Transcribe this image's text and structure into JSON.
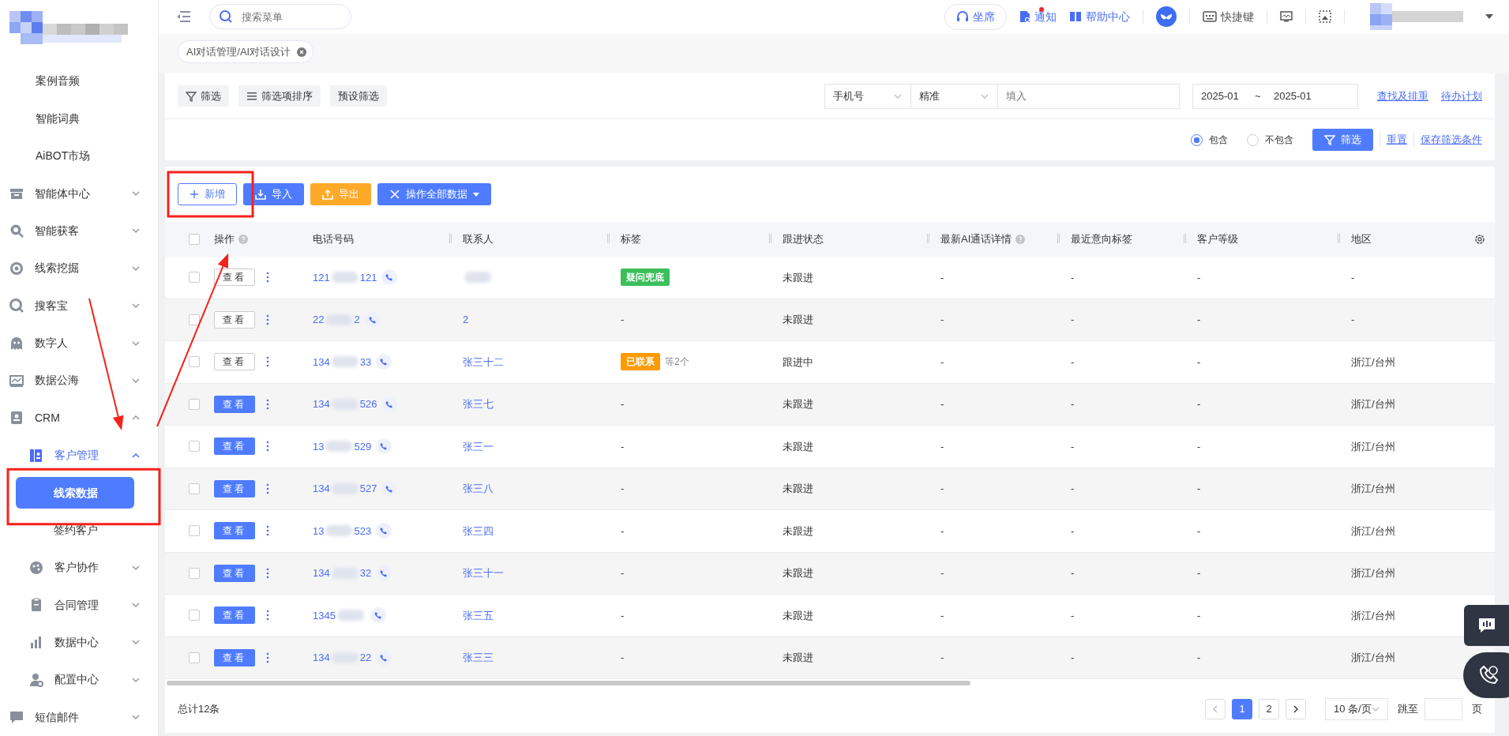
{
  "sidebar": {
    "items": [
      {
        "label": "案例音频",
        "selected": false
      },
      {
        "label": "智能词典",
        "selected": false
      },
      {
        "label": "AiBOT市场",
        "selected": false
      },
      {
        "label": "智能体中心",
        "expanded": false
      },
      {
        "label": "智能获客",
        "expanded": false
      },
      {
        "label": "线索挖掘",
        "expanded": false
      },
      {
        "label": "搜客宝",
        "expanded": false
      },
      {
        "label": "数字人",
        "expanded": false
      },
      {
        "label": "数据公海",
        "expanded": false
      },
      {
        "label": "CRM",
        "expanded": true,
        "children": [
          {
            "label": "客户管理",
            "expanded": true,
            "arrow_pointed": true,
            "children": [
              {
                "label": "线索数据",
                "selected": true,
                "boxed": true
              },
              {
                "label": "签约客户",
                "selected": false
              }
            ]
          },
          {
            "label": "客户协作",
            "expanded": false
          },
          {
            "label": "合同管理",
            "expanded": false
          },
          {
            "label": "数据中心",
            "expanded": false
          },
          {
            "label": "配置中心",
            "expanded": false
          }
        ]
      },
      {
        "label": "短信邮件",
        "expanded": false
      }
    ]
  },
  "topbar": {
    "search": {
      "placeholder": "搜索菜单"
    },
    "actions": [
      {
        "kind": "pill",
        "label": "坐席"
      },
      {
        "kind": "notify",
        "label": "通知",
        "unread": true
      },
      {
        "kind": "help",
        "label": "帮助中心"
      },
      {
        "kind": "app"
      },
      {
        "kind": "shortcut",
        "label": "快捷键"
      },
      {
        "kind": "monitor"
      },
      {
        "kind": "capture"
      },
      {
        "kind": "user"
      }
    ]
  },
  "tabs": [
    {
      "label": "AI对话管理/AI对话设计",
      "selected": true
    }
  ],
  "filter": {
    "buttons": [
      "筛选",
      "筛选项排序",
      "预设筛选"
    ],
    "field_select": "手机号",
    "match_select": "精准",
    "input": {
      "placeholder": "填入"
    },
    "date_from": "2025-01",
    "date_sep": "~",
    "date_to": "2025-01",
    "links": [
      "查找及排重",
      "待办计划"
    ],
    "radios": [
      {
        "label": "包含",
        "selected": true
      },
      {
        "label": "不包含",
        "selected": false
      }
    ],
    "apply": "筛选",
    "reset": "重置",
    "save": "保存筛选条件"
  },
  "toolbar": [
    {
      "kind": "outline",
      "label": "新增",
      "boxed": true
    },
    {
      "kind": "import",
      "label": "导入"
    },
    {
      "kind": "export",
      "label": "导出"
    },
    {
      "kind": "dropdown",
      "label": "操作全部数据"
    }
  ],
  "table": {
    "select_all": {
      "checked": false
    },
    "columns": [
      {
        "label": "操作",
        "help": true,
        "arrow_pointed": true
      },
      {
        "label": "电话号码",
        "help": false
      },
      {
        "label": "联系人",
        "help": false
      },
      {
        "label": "标签",
        "help": false
      },
      {
        "label": "跟进状态",
        "help": false
      },
      {
        "label": "最新AI通话详情",
        "help": true
      },
      {
        "label": "最近意向标签",
        "help": false
      },
      {
        "label": "客户等级",
        "help": false
      },
      {
        "label": "地区",
        "help": false
      }
    ],
    "rows": [
      {
        "checked": false,
        "view": {
          "kind": "outline",
          "label": "查看"
        },
        "phone_start": "121",
        "phone_end": "121",
        "contact_blurred": true,
        "tag": {
          "label": "疑问兜底",
          "color": "#3cbf5a"
        },
        "status": "未跟进",
        "ai": "-",
        "intent": "-",
        "level": "-",
        "region": "-"
      },
      {
        "checked": false,
        "view": {
          "kind": "outline",
          "label": "查看"
        },
        "phone_start": "22",
        "phone_end": "2",
        "contact": "2",
        "tag_text": "-",
        "status": "未跟进",
        "ai": "-",
        "intent": "-",
        "level": "-",
        "region": "-"
      },
      {
        "checked": false,
        "view": {
          "kind": "outline",
          "label": "查看"
        },
        "phone_start": "134",
        "phone_end": "33",
        "contact": "张三十二",
        "tag": {
          "label": "已联系",
          "color": "#ff9a00",
          "more": "等2个"
        },
        "status": "跟进中",
        "ai": "-",
        "intent": "-",
        "level": "-",
        "region": "浙江/台州"
      },
      {
        "checked": false,
        "view": {
          "kind": "filled",
          "label": "查看"
        },
        "phone_start": "134",
        "phone_end": "526",
        "contact": "张三七",
        "tag_text": "-",
        "status": "未跟进",
        "ai": "-",
        "intent": "-",
        "level": "-",
        "region": "浙江/台州"
      },
      {
        "checked": false,
        "view": {
          "kind": "filled",
          "label": "查看"
        },
        "phone_start": "13",
        "phone_end": "529",
        "contact": "张三一",
        "tag_text": "-",
        "status": "未跟进",
        "ai": "-",
        "intent": "-",
        "level": "-",
        "region": "浙江/台州"
      },
      {
        "checked": false,
        "view": {
          "kind": "filled",
          "label": "查看"
        },
        "phone_start": "134",
        "phone_end": "527",
        "contact": "张三八",
        "tag_text": "-",
        "status": "未跟进",
        "ai": "-",
        "intent": "-",
        "level": "-",
        "region": "浙江/台州"
      },
      {
        "checked": false,
        "view": {
          "kind": "filled",
          "label": "查看"
        },
        "phone_start": "13",
        "phone_end": "523",
        "contact": "张三四",
        "tag_text": "-",
        "status": "未跟进",
        "ai": "-",
        "intent": "-",
        "level": "-",
        "region": "浙江/台州"
      },
      {
        "checked": false,
        "view": {
          "kind": "filled",
          "label": "查看"
        },
        "phone_start": "134",
        "phone_end": "32",
        "contact": "张三十一",
        "tag_text": "-",
        "status": "未跟进",
        "ai": "-",
        "intent": "-",
        "level": "-",
        "region": "浙江/台州"
      },
      {
        "checked": false,
        "view": {
          "kind": "filled",
          "label": "查看"
        },
        "phone_start": "1345",
        "contact": "张三五",
        "tag_text": "-",
        "status": "未跟进",
        "ai": "-",
        "intent": "-",
        "level": "-",
        "region": "浙江/台州"
      },
      {
        "checked": false,
        "view": {
          "kind": "filled",
          "label": "查看"
        },
        "phone_start": "134",
        "phone_end": "22",
        "contact": "张三三",
        "tag_text": "-",
        "status": "未跟进",
        "ai": "-",
        "intent": "-",
        "level": "-",
        "region": "浙江/台州"
      }
    ]
  },
  "footer": {
    "total": "总计12条",
    "pages": [
      {
        "label": "1",
        "selected": true
      },
      {
        "label": "2",
        "selected": false
      }
    ],
    "page_size": "10 条/页",
    "jump_label": "跳至",
    "jump_unit": "页"
  },
  "annotations_shown": true
}
